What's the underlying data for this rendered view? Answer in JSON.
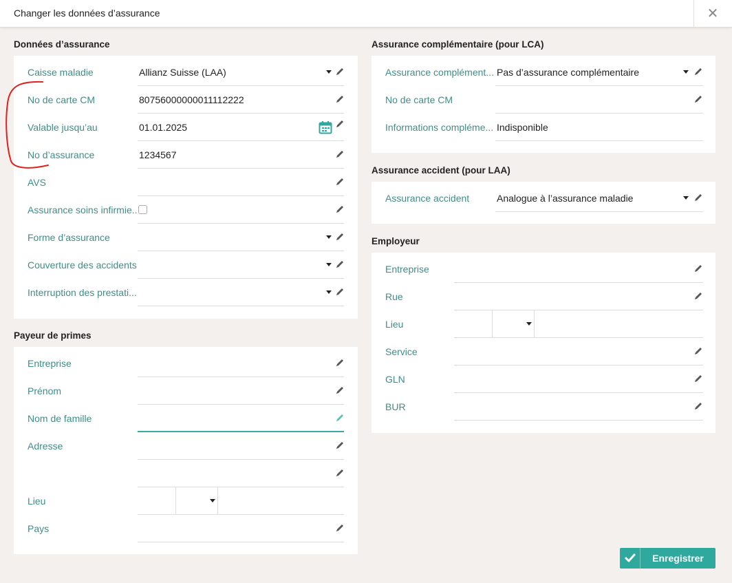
{
  "dialog": {
    "title": "Changer les données d’assurance",
    "close_glyph": "✕"
  },
  "sections": {
    "insurance": "Données d’assurance",
    "payer": "Payeur de primes",
    "lca": "Assurance complémentaire (pour LCA)",
    "laa": "Assurance accident (pour LAA)",
    "employer": "Employeur"
  },
  "insurance": {
    "fund_label": "Caisse maladie",
    "fund_value": "Allianz Suisse (LAA)",
    "card_label": "No de carte CM",
    "card_value": "80756000000011112222",
    "valid_label": "Valable jusqu’au",
    "valid_value": "01.01.2025",
    "number_label": "No d’assurance",
    "number_value": "1234567",
    "avs_label": "AVS",
    "avs_value": "",
    "nursing_label": "Assurance soins infirmie...",
    "form_label": "Forme d’assurance",
    "form_value": "",
    "coverage_label": "Couverture des accidents",
    "coverage_value": "",
    "interruption_label": "Interruption des prestati...",
    "interruption_value": ""
  },
  "payer": {
    "company_label": "Entreprise",
    "company_value": "",
    "firstname_label": "Prénom",
    "firstname_value": "",
    "lastname_label": "Nom de famille",
    "lastname_value": "",
    "address_label": "Adresse",
    "address_value": "",
    "address2_value": "",
    "place_label": "Lieu",
    "country_label": "Pays",
    "country_value": ""
  },
  "lca": {
    "insurance_label": "Assurance complément...",
    "insurance_value": "Pas d’assurance complémentaire",
    "card_label": "No de carte CM",
    "card_value": "",
    "info_label": "Informations compléme...",
    "info_value": "Indisponible"
  },
  "laa": {
    "insurance_label": "Assurance accident",
    "insurance_value": "Analogue à l’assurance maladie"
  },
  "employer": {
    "company_label": "Entreprise",
    "street_label": "Rue",
    "place_label": "Lieu",
    "service_label": "Service",
    "gln_label": "GLN",
    "bur_label": "BUR"
  },
  "footer": {
    "save_label": "Enregistrer"
  },
  "colors": {
    "accent": "#3ba99f",
    "label": "#3e8e88",
    "button": "#2fa89d",
    "annotation": "#e0201a"
  },
  "icons": [
    "close-icon",
    "pencil-icon",
    "caret-down-icon",
    "calendar-icon",
    "check-icon"
  ]
}
